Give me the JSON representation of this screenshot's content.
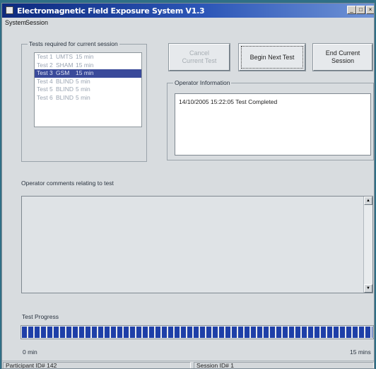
{
  "window": {
    "title": "Electromagnetic Field Exposure System V1.3",
    "controls": {
      "minimize": "_",
      "maximize": "□",
      "close": "×"
    }
  },
  "menu": [
    "System",
    "Session"
  ],
  "tests_group": {
    "label": "Tests required for current session",
    "rows": [
      {
        "test": "Test 1",
        "type": "UMTS",
        "duration": "15 min",
        "selected": false
      },
      {
        "test": "Test 2",
        "type": "SHAM",
        "duration": "15 min",
        "selected": false
      },
      {
        "test": "Test 3",
        "type": "GSM",
        "duration": "15 min",
        "selected": true
      },
      {
        "test": "Test 4",
        "type": "BLIND",
        "duration": "5 min",
        "selected": false
      },
      {
        "test": "Test 5",
        "type": "BLIND",
        "duration": "5 min",
        "selected": false
      },
      {
        "test": "Test 6",
        "type": "BLIND",
        "duration": "5 min",
        "selected": false
      }
    ]
  },
  "buttons": {
    "cancel": "Cancel Current Test",
    "begin": "Begin Next Test",
    "end": "End Current Session"
  },
  "operator_info": {
    "label": "Operator Information",
    "text": "14/10/2005 15:22:05 Test Completed"
  },
  "comments": {
    "label": "Operator comments relating to test"
  },
  "progress": {
    "label": "Test Progress",
    "fraction": 1.0,
    "min_label": "0 min",
    "max_label": "15 mins"
  },
  "status": {
    "participant": "Participant ID# 142",
    "session": "Session ID# 1"
  },
  "colors": {
    "title_bar": "#0d2a7e",
    "selection": "#3a4a9a",
    "progress": "#1e3fa8",
    "desktop": "#2f6f86"
  }
}
